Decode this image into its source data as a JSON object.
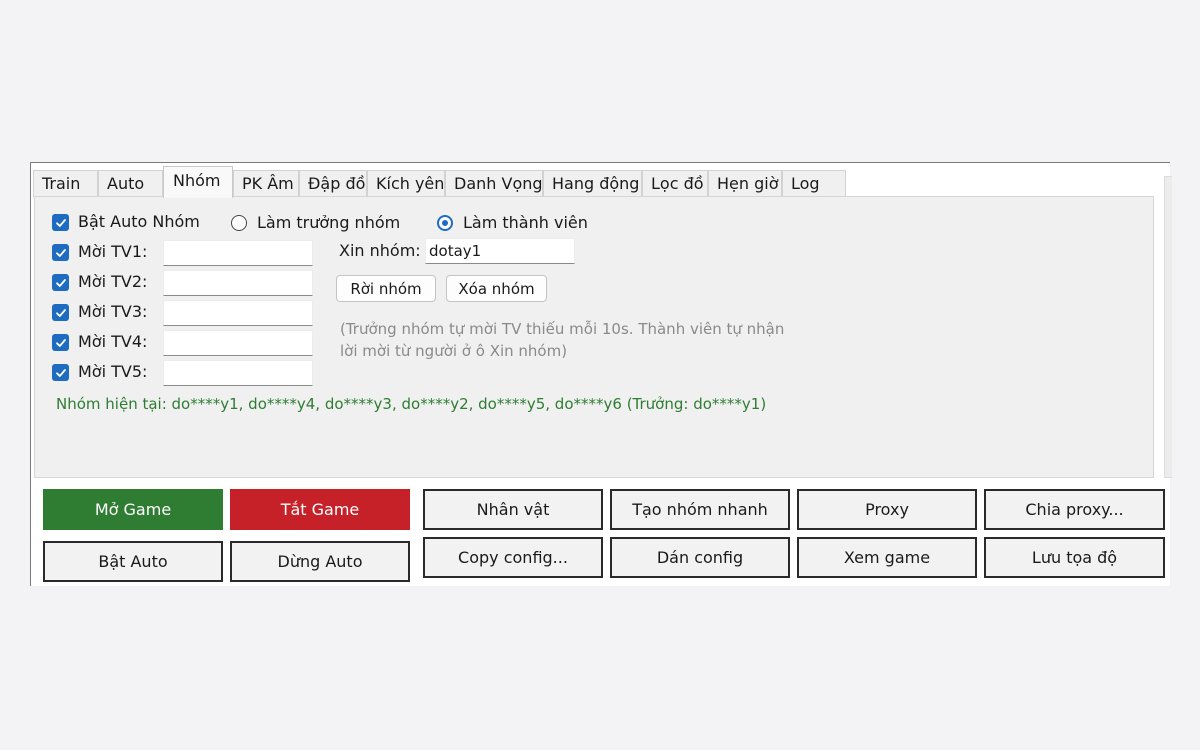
{
  "tabs": [
    {
      "label": "Train"
    },
    {
      "label": "Auto"
    },
    {
      "label": "Nhóm"
    },
    {
      "label": "PK Âm"
    },
    {
      "label": "Đập đồ"
    },
    {
      "label": "Kích yên"
    },
    {
      "label": "Danh Vọng"
    },
    {
      "label": "Hang động"
    },
    {
      "label": "Lọc đồ"
    },
    {
      "label": "Hẹn giờ"
    },
    {
      "label": "Log"
    }
  ],
  "active_tab": "Nhóm",
  "group": {
    "enable_auto_label": "Bật Auto Nhóm",
    "enable_auto_checked": true,
    "role_leader_label": "Làm trưởng nhóm",
    "role_member_label": "Làm thành viên",
    "selected_role": "member",
    "invites": [
      {
        "label": "Mời TV1:",
        "checked": true,
        "value": ""
      },
      {
        "label": "Mời TV2:",
        "checked": true,
        "value": ""
      },
      {
        "label": "Mời TV3:",
        "checked": true,
        "value": ""
      },
      {
        "label": "Mời TV4:",
        "checked": true,
        "value": ""
      },
      {
        "label": "Mời TV5:",
        "checked": true,
        "value": ""
      }
    ],
    "join_label": "Xin nhóm:",
    "join_value": "dotay1",
    "leave_button": "Rời nhóm",
    "delete_button": "Xóa nhóm",
    "hint_line1": "(Trưởng nhóm tự mời TV thiếu mỗi 10s. Thành viên tự nhận",
    "hint_line2": "lời mời từ người ở ô Xin nhóm)",
    "current_group": "Nhóm hiện tại: do****y1, do****y4, do****y3, do****y2, do****y5, do****y6  (Trưởng: do****y1)"
  },
  "buttons": {
    "open_game": "Mở Game",
    "close_game": "Tắt Game",
    "start_auto": "Bật Auto",
    "stop_auto": "Dừng Auto",
    "character": "Nhân vật",
    "quick_group": "Tạo nhóm nhanh",
    "proxy": "Proxy",
    "share_proxy": "Chia proxy...",
    "copy_config": "Copy config...",
    "paste_config": "Dán config",
    "view_game": "Xem game",
    "save_coords": "Lưu tọa độ"
  },
  "colors": {
    "accent": "#1e6bc2",
    "open_game_bg": "#2e7d32",
    "close_game_bg": "#c62128",
    "status_text": "#2e7d32",
    "hint_text": "#8a8a8a"
  }
}
